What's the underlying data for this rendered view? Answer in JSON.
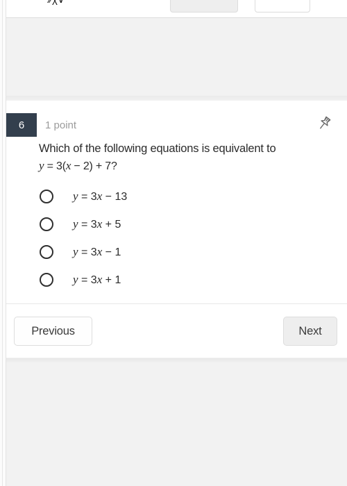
{
  "page": {
    "background_color": "#f2f2f2",
    "card_background": "#ffffff"
  },
  "card_above": {
    "text_fragment": "⁄⁄χ∨",
    "button_left_label": "",
    "button_right_label": ""
  },
  "question": {
    "number": "6",
    "points_label": "1 point",
    "pin_icon": "pushpin-icon",
    "badge_color": "#333f4d",
    "prompt_line1": "Which of the following equations is equivalent to",
    "equation": {
      "var_y": "y",
      "equals": " = 3(",
      "var_x": "x",
      "tail": " − 2) + 7?"
    },
    "options": [
      {
        "var_y": "y",
        "expr": " = 3",
        "var_x": "x",
        "tail": " − 13",
        "selected": false
      },
      {
        "var_y": "y",
        "expr": " = 3",
        "var_x": "x",
        "tail": " + 5",
        "selected": false
      },
      {
        "var_y": "y",
        "expr": " = 3",
        "var_x": "x",
        "tail": " − 1",
        "selected": false
      },
      {
        "var_y": "y",
        "expr": " = 3",
        "var_x": "x",
        "tail": " + 1",
        "selected": false
      }
    ]
  },
  "navigation": {
    "previous_label": "Previous",
    "next_label": "Next",
    "next_background": "#eeeeee"
  }
}
